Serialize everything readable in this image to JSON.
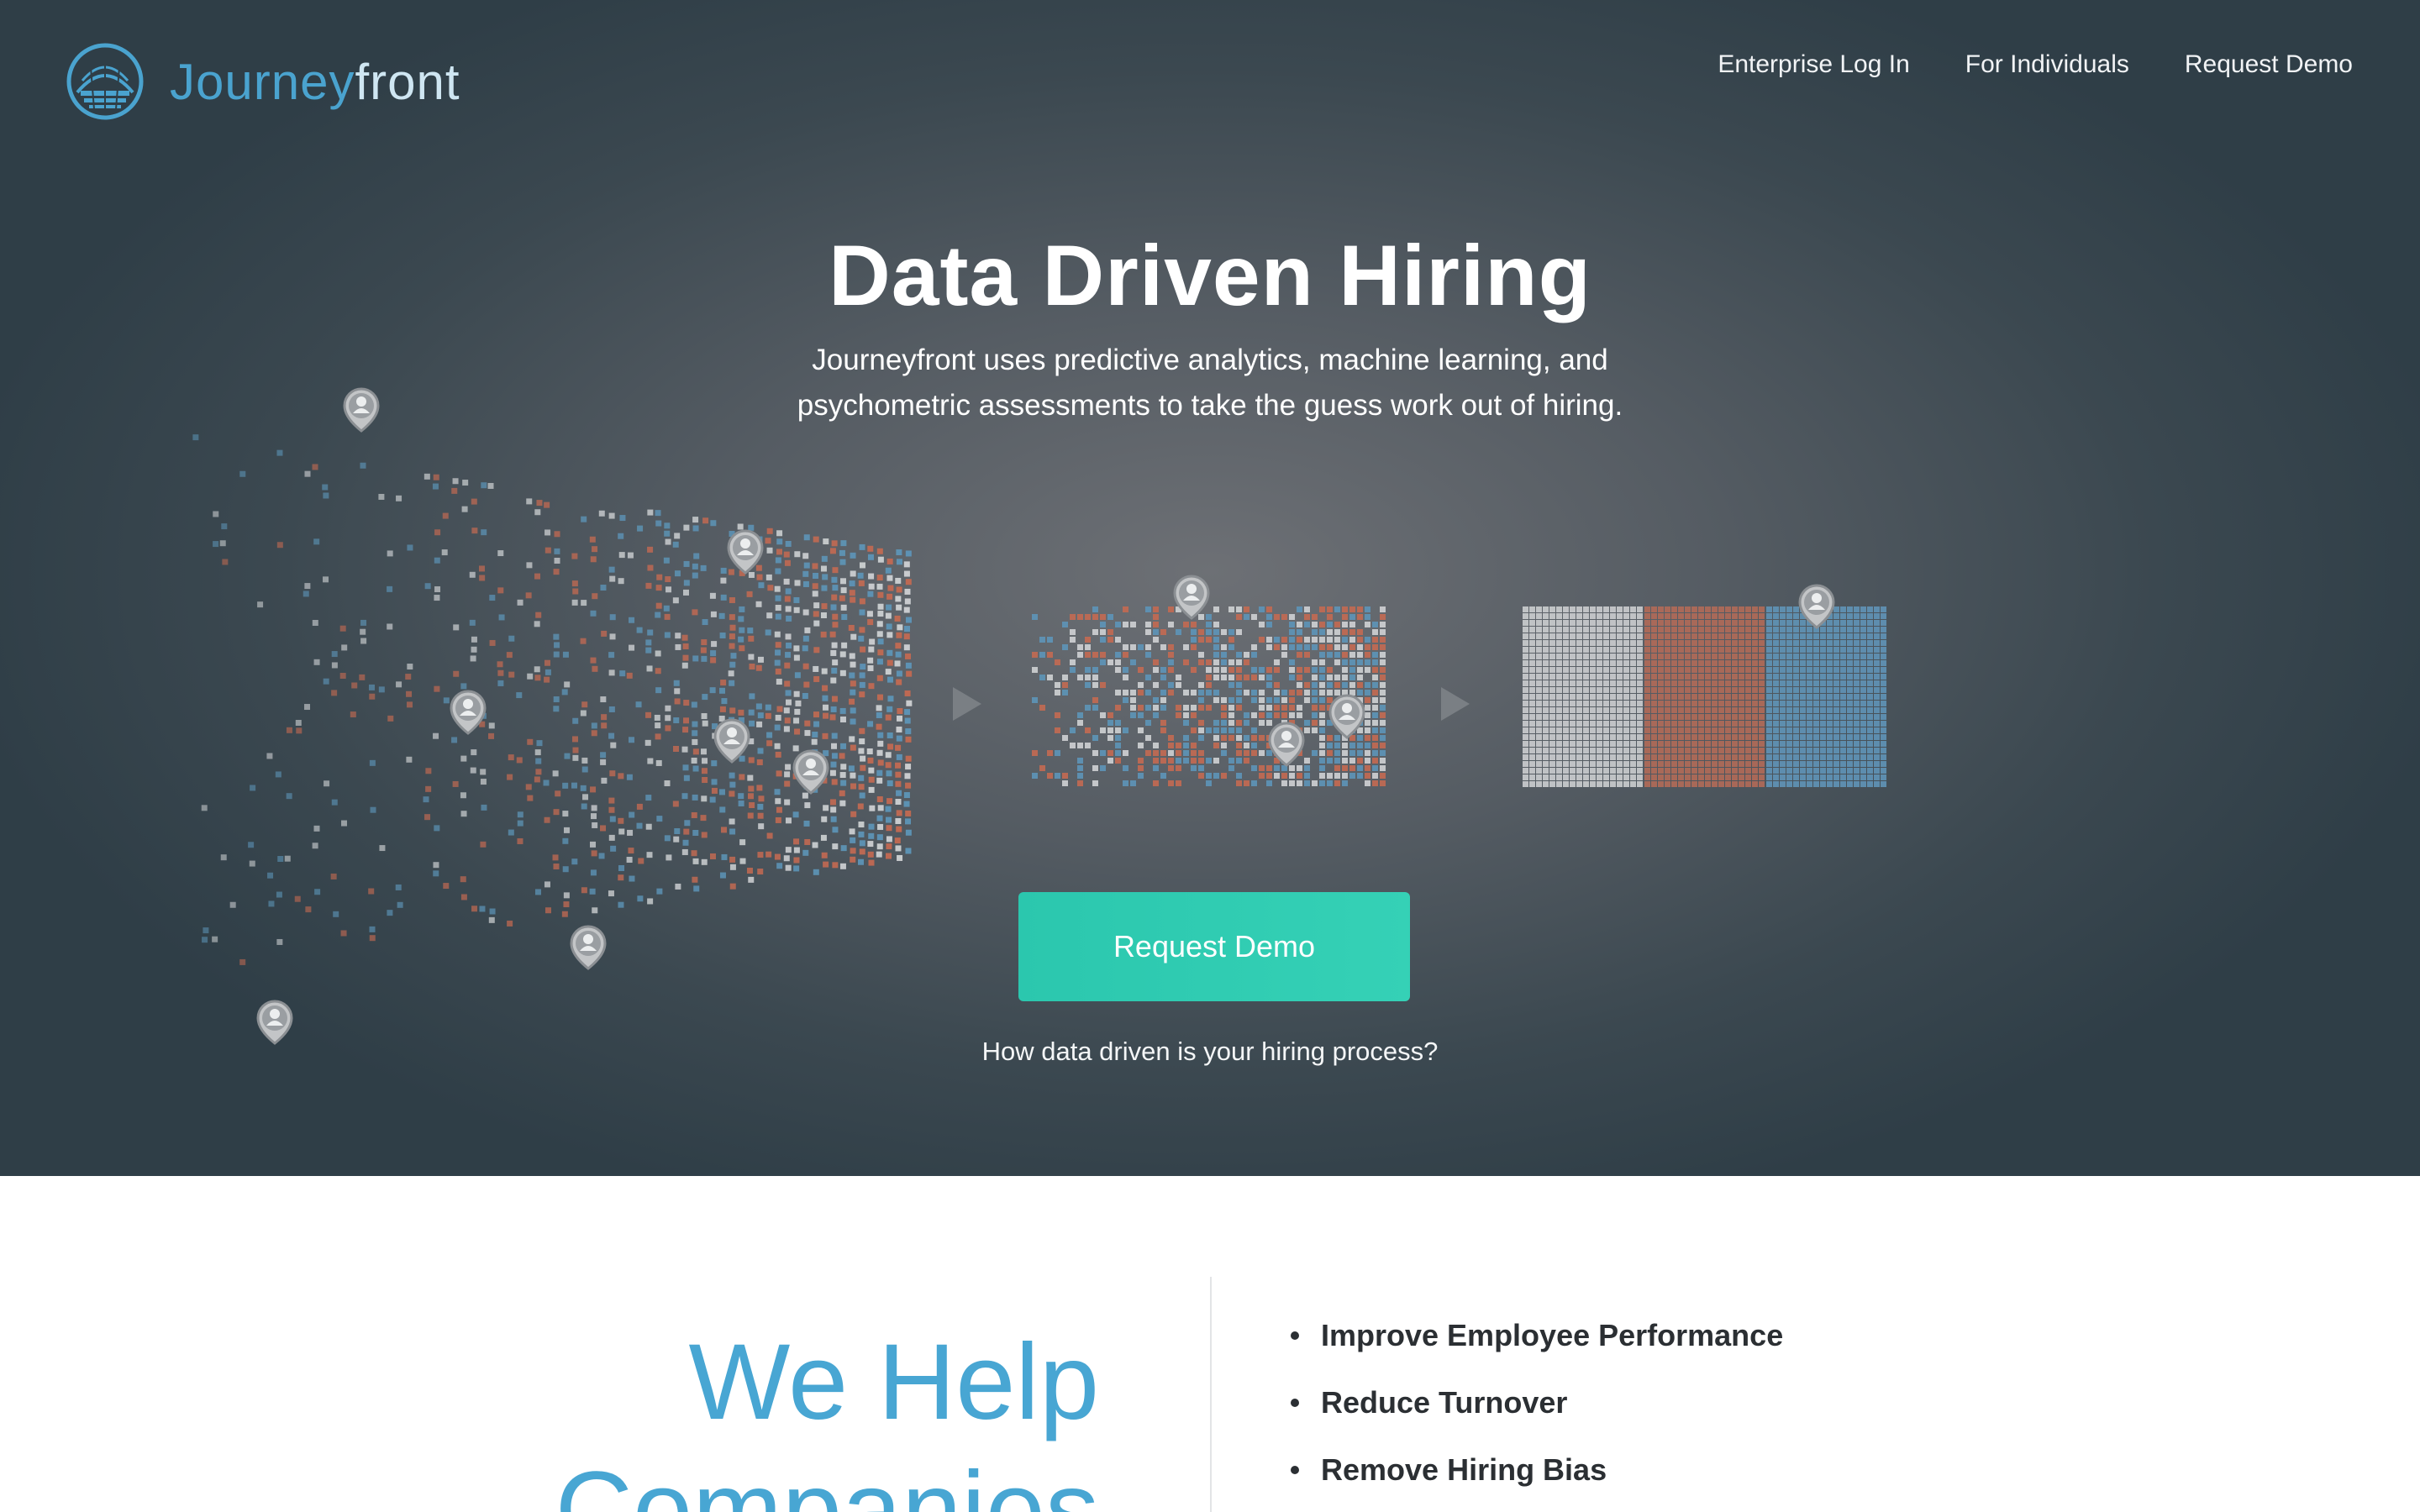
{
  "brand": {
    "name_part1": "Journey",
    "name_part2": "front",
    "accent": "#4aa3cf"
  },
  "nav": {
    "items": [
      "Enterprise Log In",
      "For Individuals",
      "Request Demo"
    ]
  },
  "hero": {
    "title": "Data Driven Hiring",
    "subtitle_line1": "Journeyfront uses predictive analytics, machine learning, and",
    "subtitle_line2": "psychometric assessments to take the guess work out of hiring.",
    "cta_label": "Request Demo",
    "cta_color": "#2bc7ae",
    "question": "How data driven is your hiring process?"
  },
  "visual": {
    "dot_colors": [
      "#cfd2d4",
      "#c36a52",
      "#5d95b8"
    ],
    "icons": [
      "person-pin-icon",
      "arrow-right-icon"
    ],
    "final_blocks": [
      "#c9cbcd",
      "#b06a58",
      "#5f93b5"
    ]
  },
  "section2": {
    "heading_line1": "We Help",
    "heading_line2": "Companies",
    "benefits": [
      "Improve Employee Performance",
      "Reduce Turnover",
      "Remove Hiring Bias"
    ]
  }
}
